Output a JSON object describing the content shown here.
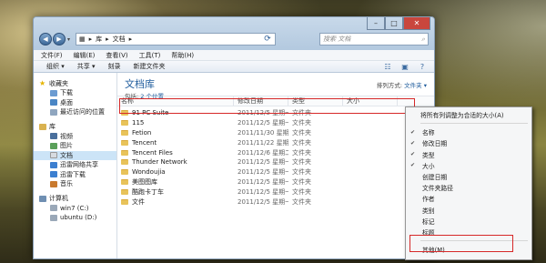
{
  "address": {
    "root": "库",
    "sep": "▸",
    "current": "文档",
    "sep2": "▸"
  },
  "search": {
    "placeholder": "搜索 文档"
  },
  "menu": [
    "文件(F)",
    "编辑(E)",
    "查看(V)",
    "工具(T)",
    "帮助(H)"
  ],
  "toolbar": {
    "organize": "组织 ▾",
    "share": "共享 ▾",
    "burn": "刻录",
    "newfolder": "新建文件夹"
  },
  "nav": {
    "favorites_label": "收藏夹",
    "favorites": [
      "下载",
      "桌面",
      "最近访问的位置"
    ],
    "libraries_label": "库",
    "libraries": [
      "视频",
      "图片",
      "文档",
      "迅雷网络共享",
      "迅雷下载",
      "音乐"
    ],
    "computer_label": "计算机",
    "drives": [
      "win7 (C:)",
      "ubuntu (D:)"
    ]
  },
  "library": {
    "title": "文档库",
    "includes_prefix": "包括:",
    "includes_link": "2 个位置",
    "arrange_prefix": "排列方式:",
    "arrange_value": "文件夹 ▾"
  },
  "columns": {
    "name": "名称",
    "date": "修改日期",
    "type": "类型",
    "size": "大小"
  },
  "files": [
    {
      "name": "91 PC Suite",
      "date": "2011/12/5 星期一 ..."
    },
    {
      "name": "115",
      "date": "2011/12/5 星期一 ..."
    },
    {
      "name": "Fetion",
      "date": "2011/11/30 星期三 ..."
    },
    {
      "name": "Tencent",
      "date": "2011/11/22 星期二 ..."
    },
    {
      "name": "Tencent Files",
      "date": "2011/12/6 星期二 ..."
    },
    {
      "name": "Thunder Network",
      "date": "2011/12/5 星期一 ..."
    },
    {
      "name": "Wondoujia",
      "date": "2011/12/5 星期一 ..."
    },
    {
      "name": "美图图库",
      "date": "2011/12/5 星期一 ..."
    },
    {
      "name": "酷跑卡丁车",
      "date": "2011/12/5 星期一 ..."
    },
    {
      "name": "文件",
      "date": "2011/12/5 星期一 ..."
    }
  ],
  "file_type_text": "文件夹",
  "context_menu": {
    "autosize": "将所有列调整为合适的大小(A)",
    "items": [
      {
        "label": "名称",
        "checked": true
      },
      {
        "label": "修改日期",
        "checked": true
      },
      {
        "label": "类型",
        "checked": true
      },
      {
        "label": "大小",
        "checked": true
      },
      {
        "label": "创建日期",
        "checked": false
      },
      {
        "label": "文件夹路径",
        "checked": false
      },
      {
        "label": "作者",
        "checked": false
      },
      {
        "label": "类别",
        "checked": false
      },
      {
        "label": "标记",
        "checked": false
      },
      {
        "label": "标题",
        "checked": false
      }
    ],
    "more": "其他(M)..."
  },
  "colors": {
    "accent": "#1e5b9c",
    "highlight": "#d62828",
    "folder": "#e8c35a"
  }
}
